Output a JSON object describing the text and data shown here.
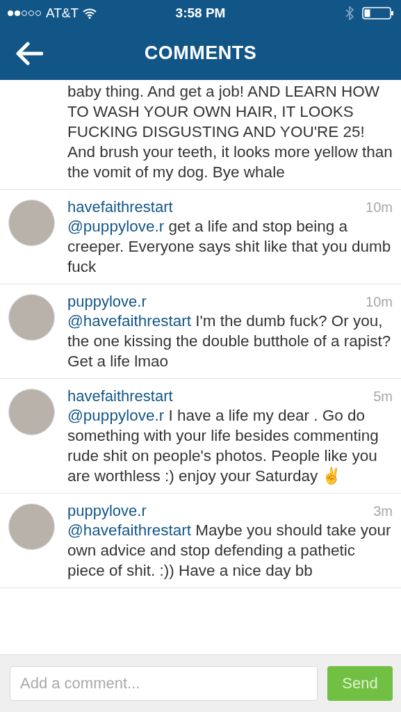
{
  "status_bar": {
    "carrier": "AT&T",
    "time": "3:58 PM"
  },
  "header": {
    "title": "COMMENTS"
  },
  "comments": [
    {
      "kind": "continued",
      "text": "baby thing. And get a job! AND LEARN HOW TO WASH YOUR OWN HAIR, IT LOOKS FUCKING DISGUSTING AND YOU'RE 25! And brush your teeth, it looks more yellow than the vomit of my dog. Bye whale"
    },
    {
      "kind": "full",
      "username": "havefaithrestart",
      "time": "10m",
      "mention": "@puppylove.r",
      "text": " get a life and stop being a creeper. Everyone says shit like that you dumb fuck"
    },
    {
      "kind": "full",
      "username": "puppylove.r",
      "time": "10m",
      "mention": "@havefaithrestart",
      "text": " I'm the dumb fuck? Or you, the one kissing the double butthole of a rapist? Get a life lmao"
    },
    {
      "kind": "full",
      "username": "havefaithrestart",
      "time": "5m",
      "mention": "@puppylove.r",
      "text": " I have a life my dear . Go do something with your life besides commenting rude shit on people's photos. People like you are worthless :) enjoy your Saturday ✌"
    },
    {
      "kind": "full",
      "username": "puppylove.r",
      "time": "3m",
      "mention": "@havefaithrestart",
      "text": " Maybe you should take your own advice and stop defending a pathetic piece of shit. :)) Have a nice day bb"
    }
  ],
  "composer": {
    "placeholder": "Add a comment...",
    "button": "Send"
  }
}
